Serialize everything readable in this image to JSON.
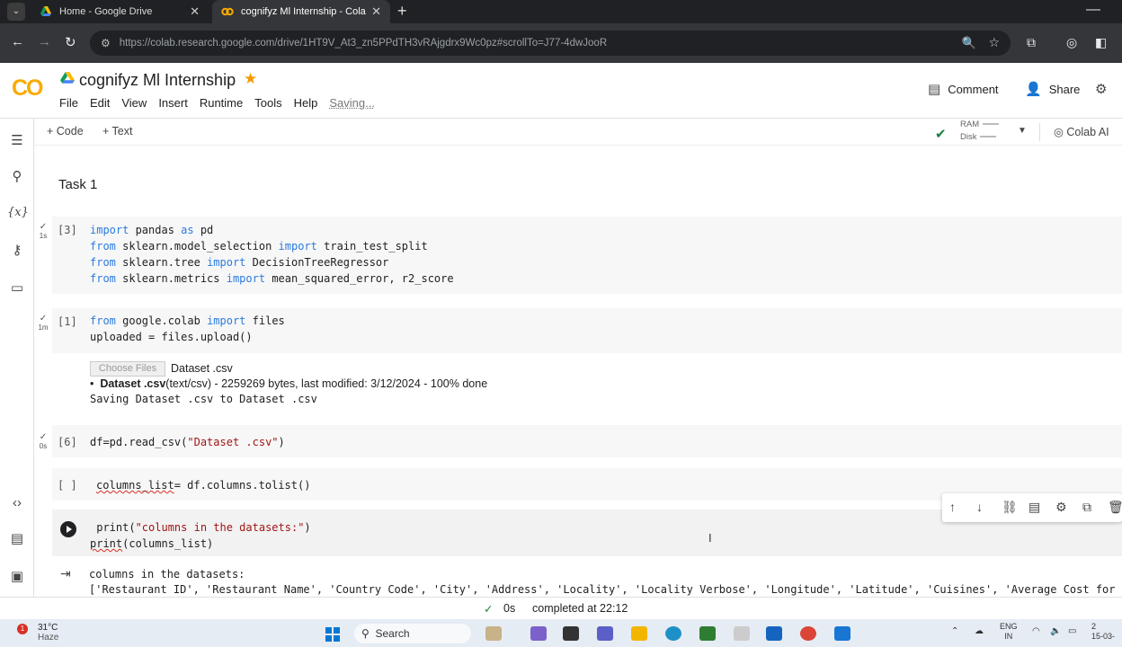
{
  "browser": {
    "tabs": [
      {
        "title": "Home - Google Drive"
      },
      {
        "title": "cognifyz Ml Internship - Colab"
      }
    ],
    "url": "https://colab.research.google.com/drive/1HT9V_At3_zn5PPdTH3vRAjgdrx9Wc0pz#scrollTo=J77-4dwJooR"
  },
  "colab": {
    "logo": "CO",
    "title": "cognifyz Ml Internship",
    "menu": [
      "File",
      "Edit",
      "View",
      "Insert",
      "Runtime",
      "Tools",
      "Help"
    ],
    "saving": "Saving...",
    "comment": "Comment",
    "share": "Share",
    "toolbar": {
      "code": "+ Code",
      "text": "+ Text",
      "ram": "RAM",
      "disk": "Disk",
      "colab_ai": "Colab AI"
    }
  },
  "notebook": {
    "heading": "Task 1",
    "cell1": {
      "exec": "[3]",
      "status": "1s"
    },
    "cell2": {
      "exec": "[1]",
      "status": "1m"
    },
    "cell3": {
      "exec": "[6]",
      "status": "0s"
    },
    "cell4": {
      "exec": "[ ]"
    },
    "upload": {
      "button": "Choose Files",
      "file": "Dataset .csv",
      "detail_name": "Dataset .csv",
      "detail_rest": "(text/csv) - 2259269 bytes, last modified: 3/12/2024 - 100% done",
      "saving": "Saving Dataset .csv to Dataset .csv"
    },
    "output": {
      "line1": "columns in the datasets:",
      "line2": "['Restaurant ID', 'Restaurant Name', 'Country Code', 'City', 'Address', 'Locality', 'Locality Verbose', 'Longitude', 'Latitude', 'Cuisines', 'Average Cost for t"
    }
  },
  "status": {
    "duration": "0s",
    "completed": "completed at 22:12"
  },
  "taskbar": {
    "temp": "31°C",
    "condition": "Haze",
    "search": "Search",
    "lang1": "ENG",
    "lang2": "IN",
    "date": "15-03-"
  }
}
